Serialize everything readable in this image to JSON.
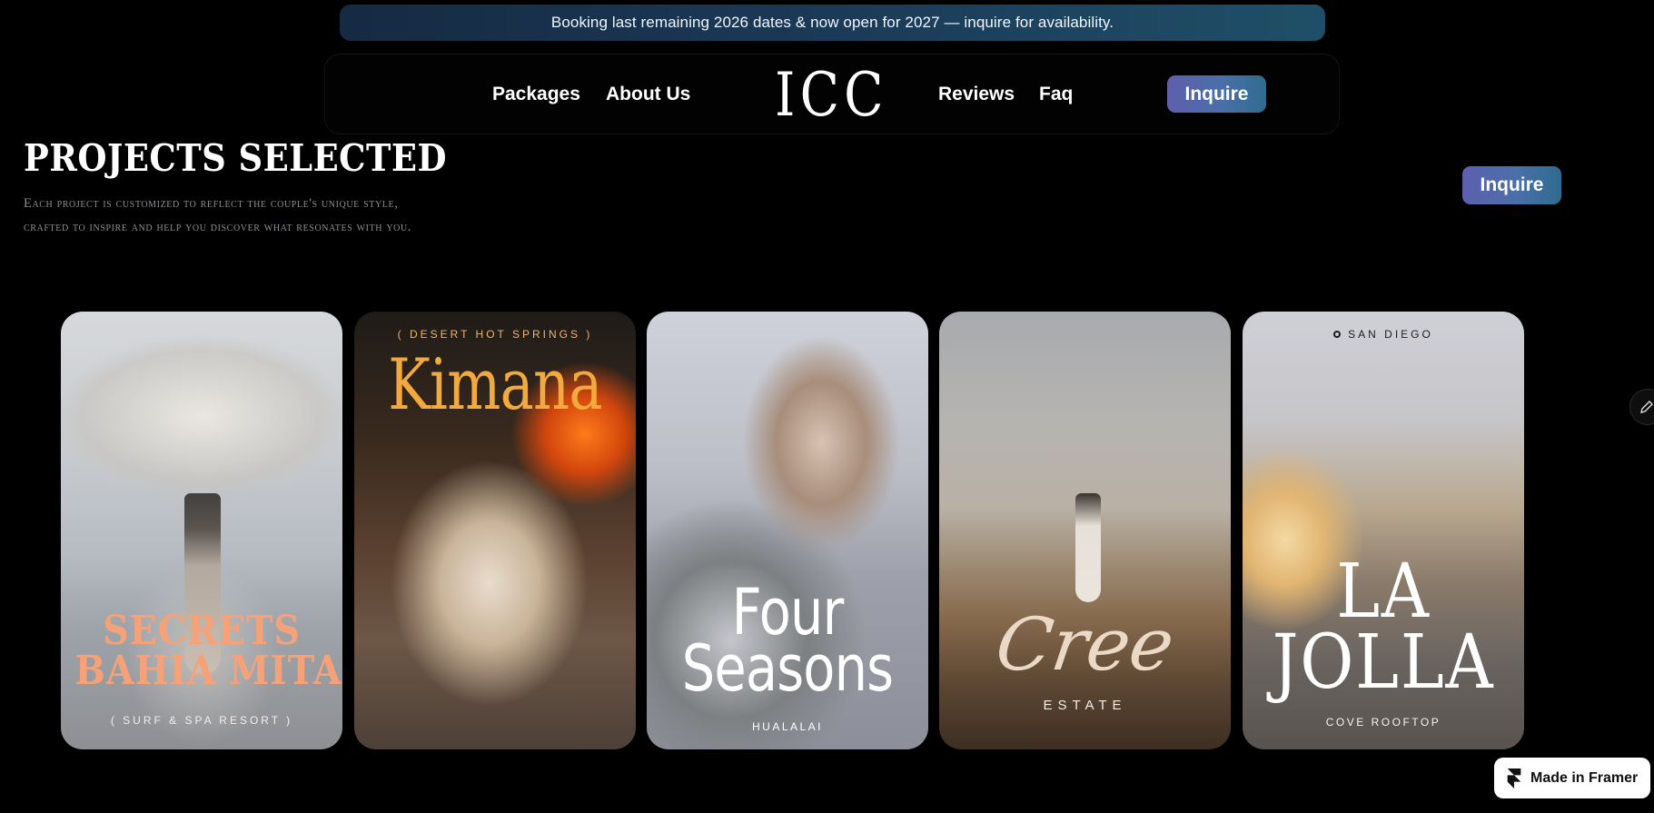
{
  "banner": {
    "text": "Booking last remaining 2026 dates & now open for 2027 — inquire for availability."
  },
  "nav": {
    "links_left": [
      "Packages",
      "About Us"
    ],
    "logo": "ICC",
    "links_right": [
      "Reviews",
      "Faq"
    ],
    "inquire_label": "Inquire"
  },
  "hero": {
    "title": "PROJECTS SELECTED",
    "subtitle_line1": "Each project is customized to reflect the couple's unique style,",
    "subtitle_line2": "crafted to inspire and help you discover what resonates with you.",
    "inquire_label": "Inquire"
  },
  "projects": [
    {
      "title_line1": "SECRETS",
      "title_line2": "BAHIA MITA",
      "caption": "( SURF & SPA RESORT )"
    },
    {
      "location": "( DESERT HOT SPRINGS )",
      "title": "Kimana"
    },
    {
      "title_line1": "Four",
      "title_line2": "Seasons",
      "caption": "HUALALAI"
    },
    {
      "title": "Cree",
      "caption": "ESTATE"
    },
    {
      "location": "SAN DIEGO",
      "title_line1": "LA",
      "title_line2": "JOLLA",
      "caption": "COVE ROOFTOP"
    }
  ],
  "framer_badge": {
    "label": "Made in Framer"
  },
  "icons": {
    "edit": "pencil-icon",
    "location": "map-pin-icon",
    "framer": "framer-logo-icon"
  }
}
